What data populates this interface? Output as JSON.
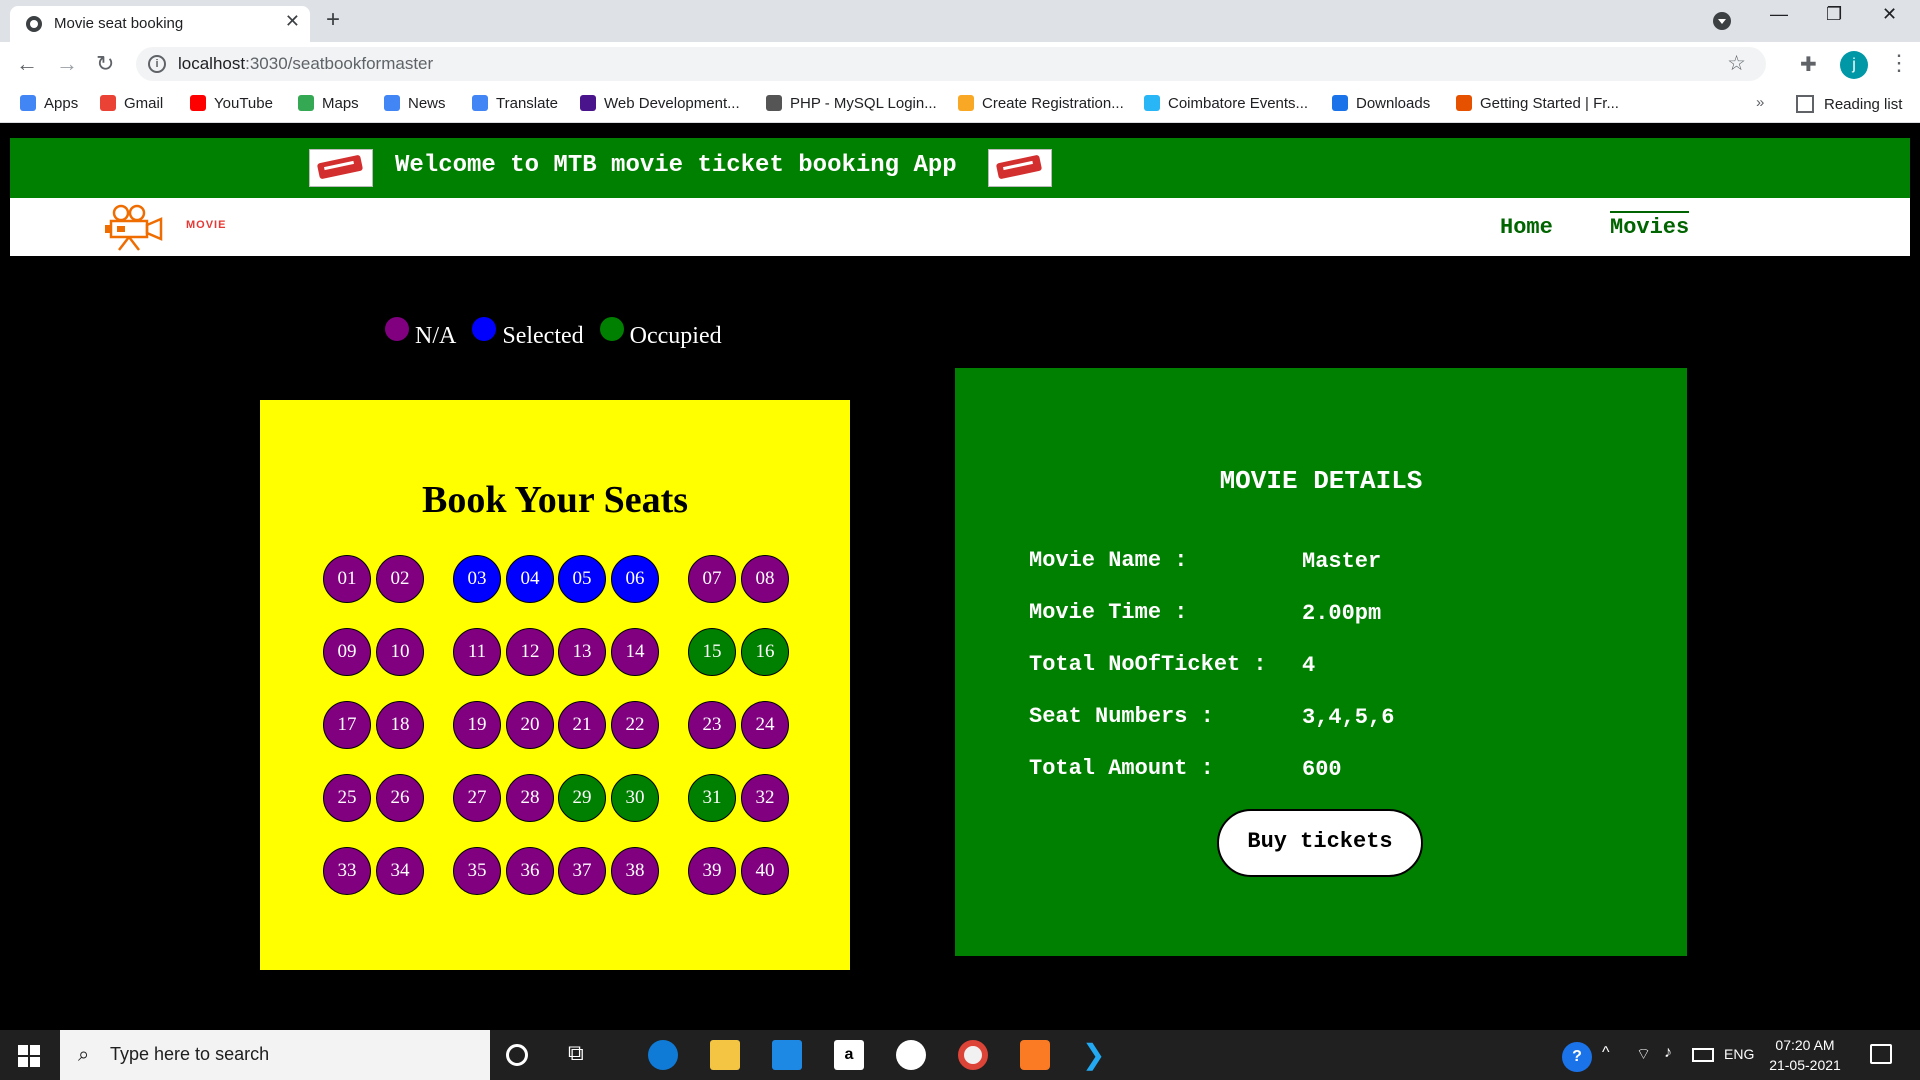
{
  "browser": {
    "tab_title": "Movie seat booking",
    "url_host": "localhost",
    "url_path": ":3030/seatbookformaster",
    "bookmarks": [
      {
        "label": "Apps",
        "color": "#ea4335"
      },
      {
        "label": "Gmail",
        "color": "#ea4335"
      },
      {
        "label": "YouTube",
        "color": "#ff0000"
      },
      {
        "label": "Maps",
        "color": "#34a853"
      },
      {
        "label": "News",
        "color": "#4285f4"
      },
      {
        "label": "Translate",
        "color": "#4285f4"
      },
      {
        "label": "Web Development...",
        "color": "#4a148c"
      },
      {
        "label": "PHP - MySQL Login...",
        "color": "#555555"
      },
      {
        "label": "Create Registration...",
        "color": "#f9a825"
      },
      {
        "label": "Coimbatore Events...",
        "color": "#29b6f6"
      },
      {
        "label": "Downloads",
        "color": "#1a73e8"
      },
      {
        "label": "Getting Started | Fr...",
        "color": "#e65100"
      }
    ],
    "bookmarks_more": "»",
    "reading_list": "Reading list",
    "profile_initial": "j"
  },
  "app": {
    "banner_text": "Welcome to MTB movie ticket booking App",
    "logo_text": "MOVIE",
    "nav": {
      "home": "Home",
      "movies": "Movies"
    },
    "legend": [
      {
        "label": "N/A",
        "color": "#800080"
      },
      {
        "label": "Selected",
        "color": "#0000ff"
      },
      {
        "label": "Occupied",
        "color": "#008000"
      }
    ],
    "seat_title": "Book Your Seats",
    "seats": [
      {
        "n": "01",
        "s": "na"
      },
      {
        "n": "02",
        "s": "na"
      },
      {
        "n": "03",
        "s": "selected"
      },
      {
        "n": "04",
        "s": "selected"
      },
      {
        "n": "05",
        "s": "selected"
      },
      {
        "n": "06",
        "s": "selected"
      },
      {
        "n": "07",
        "s": "na"
      },
      {
        "n": "08",
        "s": "na"
      },
      {
        "n": "09",
        "s": "na"
      },
      {
        "n": "10",
        "s": "na"
      },
      {
        "n": "11",
        "s": "na"
      },
      {
        "n": "12",
        "s": "na"
      },
      {
        "n": "13",
        "s": "na"
      },
      {
        "n": "14",
        "s": "na"
      },
      {
        "n": "15",
        "s": "occupied"
      },
      {
        "n": "16",
        "s": "occupied"
      },
      {
        "n": "17",
        "s": "na"
      },
      {
        "n": "18",
        "s": "na"
      },
      {
        "n": "19",
        "s": "na"
      },
      {
        "n": "20",
        "s": "na"
      },
      {
        "n": "21",
        "s": "na"
      },
      {
        "n": "22",
        "s": "na"
      },
      {
        "n": "23",
        "s": "na"
      },
      {
        "n": "24",
        "s": "na"
      },
      {
        "n": "25",
        "s": "na"
      },
      {
        "n": "26",
        "s": "na"
      },
      {
        "n": "27",
        "s": "na"
      },
      {
        "n": "28",
        "s": "na"
      },
      {
        "n": "29",
        "s": "occupied"
      },
      {
        "n": "30",
        "s": "occupied"
      },
      {
        "n": "31",
        "s": "occupied"
      },
      {
        "n": "32",
        "s": "na"
      },
      {
        "n": "33",
        "s": "na"
      },
      {
        "n": "34",
        "s": "na"
      },
      {
        "n": "35",
        "s": "na"
      },
      {
        "n": "36",
        "s": "na"
      },
      {
        "n": "37",
        "s": "na"
      },
      {
        "n": "38",
        "s": "na"
      },
      {
        "n": "39",
        "s": "na"
      },
      {
        "n": "40",
        "s": "na"
      }
    ],
    "details": {
      "title": "MOVIE DETAILS",
      "rows": [
        {
          "label": "Movie Name :",
          "value": "Master"
        },
        {
          "label": "Movie Time :",
          "value": "2.00pm"
        },
        {
          "label": "Total NoOfTicket :",
          "value": "4"
        },
        {
          "label": "Seat Numbers :",
          "value": "3,4,5,6"
        },
        {
          "label": "Total Amount :",
          "value": "600"
        }
      ],
      "buy_label": "Buy tickets"
    }
  },
  "taskbar": {
    "search_placeholder": "Type here to search",
    "lang": "ENG",
    "time": "07:20 AM",
    "date": "21-05-2021"
  }
}
